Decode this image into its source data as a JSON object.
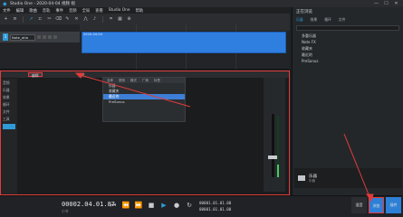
{
  "window": {
    "title": "Studio One - 2020-04-04 视频 视",
    "min": "—",
    "max": "☐",
    "close": "✕"
  },
  "menu": [
    "文件",
    "编辑",
    "歌曲",
    "音轨",
    "事件",
    "音频",
    "全局",
    "查看",
    "Studio One",
    "帮助"
  ],
  "track": {
    "number": "1",
    "name": "Note_atio"
  },
  "clip_label": "2020-04-04",
  "edit_panel": {
    "tabs": [
      "编辑",
      "浏览"
    ],
    "left_labels": [
      "音频",
      "乐器",
      "效果",
      "循环",
      "文件",
      "工具"
    ]
  },
  "popup": {
    "header": [
      "名称",
      "类别",
      "格式",
      "厂商",
      "标签"
    ],
    "rows": [
      "仪器",
      "收藏夹",
      "最近的",
      "PreSonus"
    ]
  },
  "browser": {
    "title": "正在浏览",
    "tabs": [
      "乐器",
      "效果",
      "循环",
      "文件"
    ],
    "items": [
      "多重乐器",
      "Note FX",
      "收藏夹",
      "最近的",
      "PreSonus"
    ],
    "folder_title": "乐器",
    "folder_sub": "乐器"
  },
  "transport": {
    "time": "00002.04.01.87",
    "time_label": "小节",
    "sec1": "00001.01.01.00",
    "sec2": "00001.01.01.00"
  },
  "bottom_tabs": [
    "混音",
    "浏览",
    "插件"
  ],
  "colors": {
    "accent": "#2e9bd6",
    "highlight": "#e23b3b",
    "clip": "#2f7fe0"
  }
}
